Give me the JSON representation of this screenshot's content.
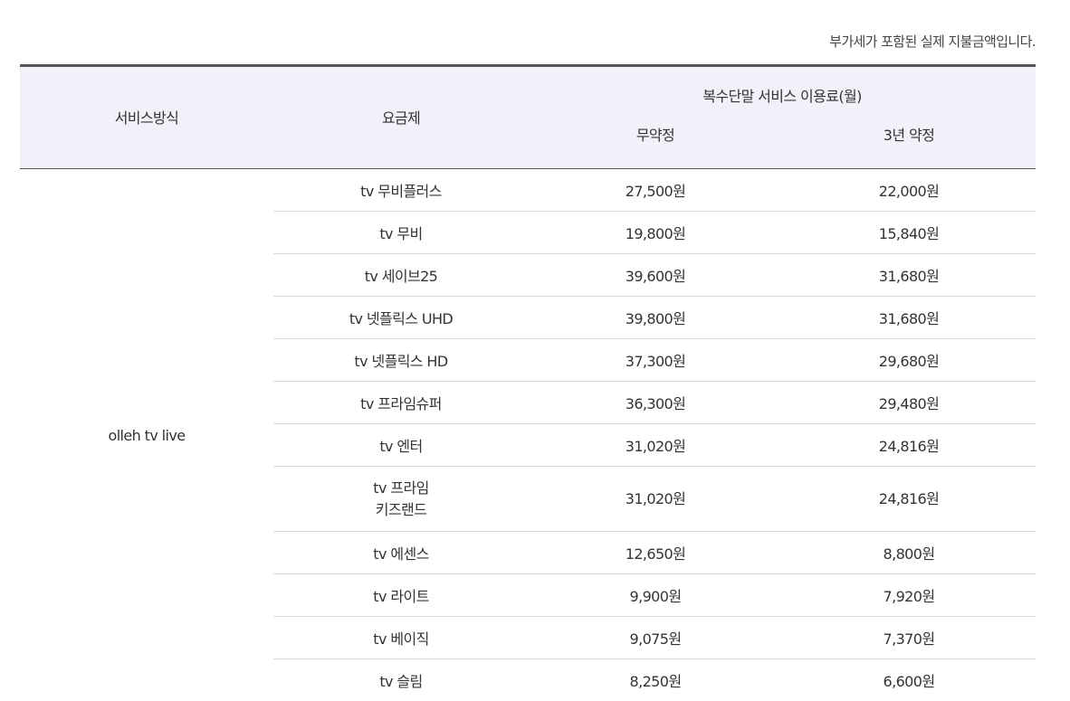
{
  "note": "부가세가 포함된 실제 지불금액입니다.",
  "header": {
    "service_method": "서비스방식",
    "plan": "요금제",
    "group": "복수단말 서비스 이용료(월)",
    "no_contract": "무약정",
    "three_year": "3년 약정"
  },
  "service_name": "olleh tv live",
  "rows": [
    {
      "plan": "tv 무비플러스",
      "no_contract": "27,500원",
      "three_year": "22,000원"
    },
    {
      "plan": "tv 무비",
      "no_contract": "19,800원",
      "three_year": "15,840원"
    },
    {
      "plan": "tv 세이브25",
      "no_contract": "39,600원",
      "three_year": "31,680원"
    },
    {
      "plan": "tv 넷플릭스 UHD",
      "no_contract": "39,800원",
      "three_year": "31,680원"
    },
    {
      "plan": "tv 넷플릭스 HD",
      "no_contract": "37,300원",
      "three_year": "29,680원"
    },
    {
      "plan": "tv 프라임슈퍼",
      "no_contract": "36,300원",
      "three_year": "29,480원"
    },
    {
      "plan": "tv 엔터",
      "no_contract": "31,020원",
      "three_year": "24,816원"
    },
    {
      "plan_line1": "tv 프라임",
      "plan_line2": "키즈랜드",
      "no_contract": "31,020원",
      "three_year": "24,816원"
    },
    {
      "plan": "tv 에센스",
      "no_contract": "12,650원",
      "three_year": "8,800원"
    },
    {
      "plan": "tv 라이트",
      "no_contract": "9,900원",
      "three_year": "7,920원"
    },
    {
      "plan": "tv 베이직",
      "no_contract": "9,075원",
      "three_year": "7,370원"
    },
    {
      "plan": "tv 슬림",
      "no_contract": "8,250원",
      "three_year": "6,600원"
    }
  ]
}
